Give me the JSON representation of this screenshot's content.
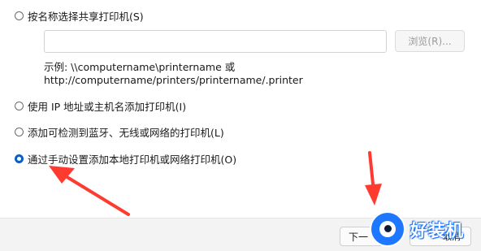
{
  "options": [
    {
      "label": "按名称选择共享打印机(S)",
      "checked": false
    },
    {
      "label": "使用 IP 地址或主机名添加打印机(I)",
      "checked": false
    },
    {
      "label": "添加可检测到蓝牙、无线或网络的打印机(L)",
      "checked": false
    },
    {
      "label": "通过手动设置添加本地打印机或网络打印机(O)",
      "checked": true
    }
  ],
  "share_path": {
    "value": "",
    "browse_label": "浏览(R)..."
  },
  "example": {
    "line1": "示例: \\\\computername\\printername 或",
    "line2": "http://computername/printers/printername/.printer"
  },
  "footer": {
    "next_label": "下一",
    "cancel_label": "取消"
  },
  "watermark": {
    "text": "好装机"
  },
  "colors": {
    "accent": "#0a5fc4",
    "arrow": "#ff3b30",
    "watermark": "#1e78ff"
  }
}
